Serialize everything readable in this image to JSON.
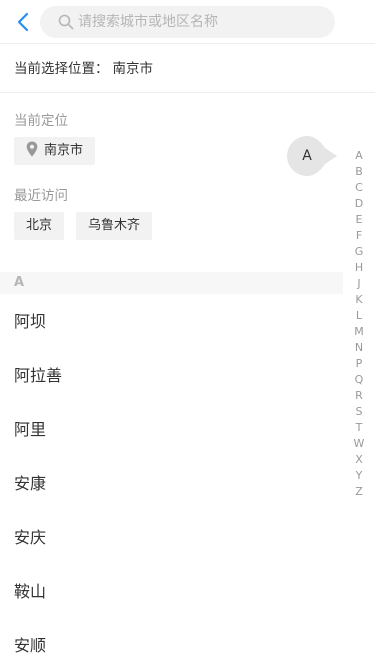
{
  "header": {
    "back_icon": "chevron-left-icon",
    "search_icon": "search-icon",
    "search_placeholder": "请搜索城市或地区名称",
    "accent_color": "#2a8df0"
  },
  "current_selection": {
    "label": "当前选择位置：",
    "value": "南京市"
  },
  "location": {
    "title": "当前定位",
    "icon": "location-pin-icon",
    "city": "南京市"
  },
  "recent": {
    "title": "最近访问",
    "cities": [
      "北京",
      "乌鲁木齐"
    ]
  },
  "index_bubble": {
    "letter": "A"
  },
  "group": {
    "letter": "A",
    "cities": [
      "阿坝",
      "阿拉善",
      "阿里",
      "安康",
      "安庆",
      "鞍山",
      "安顺"
    ]
  },
  "alphabet": [
    "A",
    "B",
    "C",
    "D",
    "E",
    "F",
    "G",
    "H",
    "J",
    "K",
    "L",
    "M",
    "N",
    "P",
    "Q",
    "R",
    "S",
    "T",
    "W",
    "X",
    "Y",
    "Z"
  ]
}
